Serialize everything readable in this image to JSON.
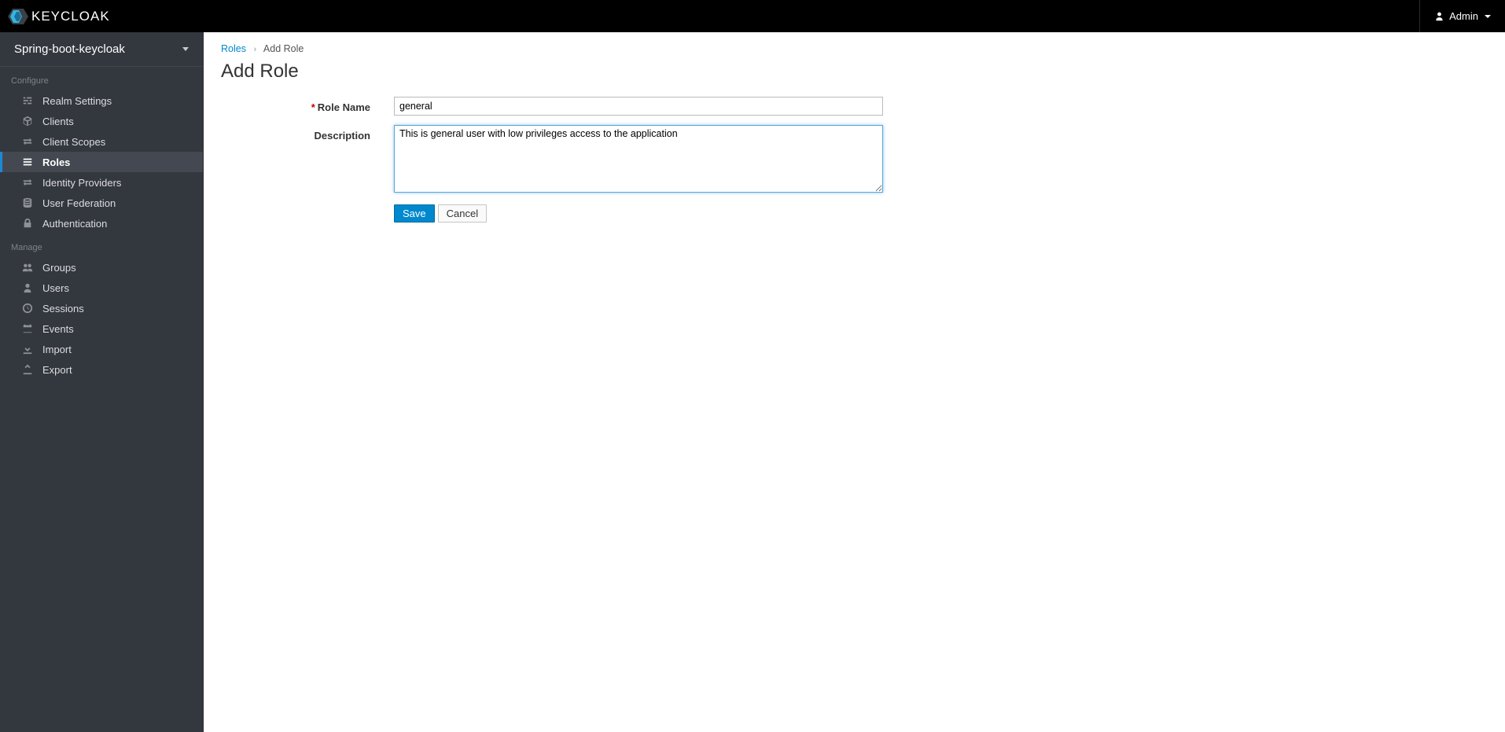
{
  "header": {
    "brand_main": "KEY",
    "brand_sub": "CLOAK",
    "user_label": "Admin"
  },
  "sidebar": {
    "realm": "Spring-boot-keycloak",
    "sections": [
      {
        "title": "Configure",
        "items": [
          {
            "icon": "sliders",
            "label": "Realm Settings"
          },
          {
            "icon": "cube",
            "label": "Clients"
          },
          {
            "icon": "transfer",
            "label": "Client Scopes"
          },
          {
            "icon": "list",
            "label": "Roles",
            "active": true
          },
          {
            "icon": "transfer",
            "label": "Identity Providers"
          },
          {
            "icon": "database",
            "label": "User Federation"
          },
          {
            "icon": "lock",
            "label": "Authentication"
          }
        ]
      },
      {
        "title": "Manage",
        "items": [
          {
            "icon": "group",
            "label": "Groups"
          },
          {
            "icon": "user",
            "label": "Users"
          },
          {
            "icon": "clock",
            "label": "Sessions"
          },
          {
            "icon": "calendar",
            "label": "Events"
          },
          {
            "icon": "import",
            "label": "Import"
          },
          {
            "icon": "export",
            "label": "Export"
          }
        ]
      }
    ]
  },
  "breadcrumb": {
    "root": "Roles",
    "current": "Add Role"
  },
  "page": {
    "title": "Add Role",
    "role_name_label": "Role Name",
    "role_name_value": "general",
    "description_label": "Description",
    "description_value": "This is general user with low privileges access to the application",
    "save_label": "Save",
    "cancel_label": "Cancel"
  }
}
